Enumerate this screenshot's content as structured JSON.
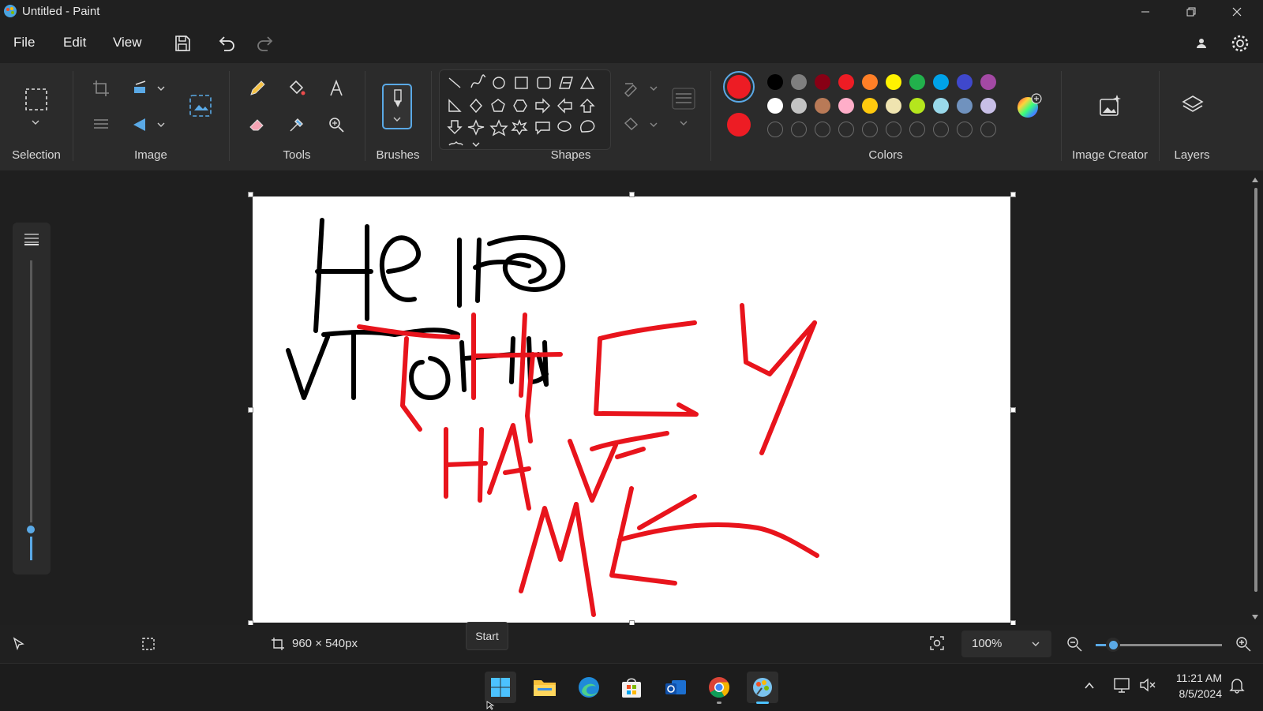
{
  "window": {
    "title": "Untitled - Paint"
  },
  "menu": {
    "file": "File",
    "edit": "Edit",
    "view": "View"
  },
  "ribbon": {
    "selection_label": "Selection",
    "image_label": "Image",
    "tools_label": "Tools",
    "brushes_label": "Brushes",
    "shapes_label": "Shapes",
    "colors_label": "Colors",
    "image_creator_label": "Image Creator",
    "layers_label": "Layers"
  },
  "colors": {
    "primary": "#ed1c24",
    "secondary": "#ed1c24",
    "palette_row1": [
      "#000000",
      "#7f7f7f",
      "#880015",
      "#ed1c24",
      "#ff7f27",
      "#fff200",
      "#22b14c",
      "#00a2e8",
      "#3f48cc",
      "#a349a4"
    ],
    "palette_row2": [
      "#ffffff",
      "#c3c3c3",
      "#b97a57",
      "#ffaec9",
      "#ffc90e",
      "#efe4b0",
      "#b5e61d",
      "#99d9ea",
      "#7092be",
      "#c8bfe7"
    ]
  },
  "canvas": {
    "background": "#ffffff",
    "ink_colors": [
      "#000000",
      "#e8141c"
    ]
  },
  "status": {
    "canvas_size": "960 × 540px",
    "zoom": "100%"
  },
  "tooltip": {
    "text": "Start"
  },
  "taskbar": {
    "time": "11:21 AM",
    "date": "8/5/2024",
    "apps": [
      "start",
      "file-explorer",
      "edge",
      "store",
      "outlook",
      "chrome",
      "paint"
    ]
  }
}
